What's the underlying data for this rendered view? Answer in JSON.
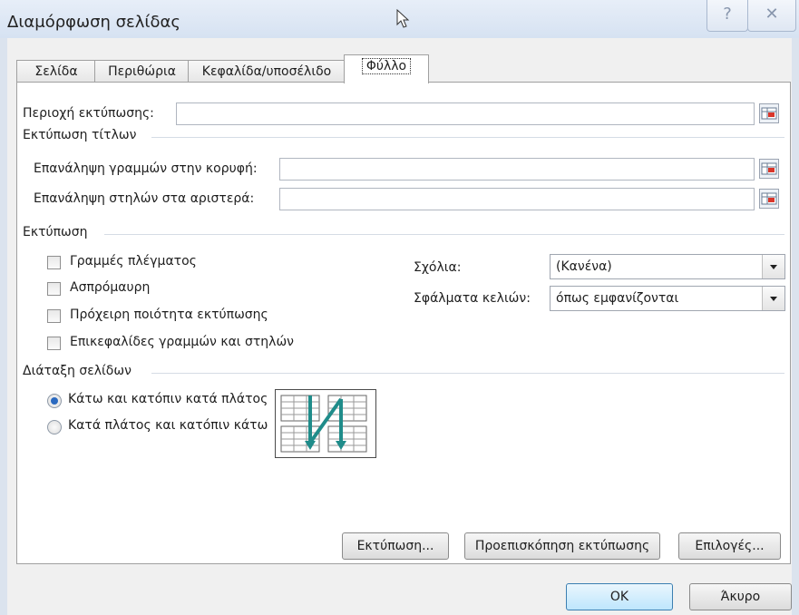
{
  "window": {
    "title": "Διαμόρφωση σελίδας",
    "help_icon": "help-icon",
    "close_icon": "close-icon"
  },
  "tabs": [
    {
      "label": "Σελίδα",
      "active": false
    },
    {
      "label": "Περιθώρια",
      "active": false
    },
    {
      "label": "Κεφαλίδα/υποσέλιδο",
      "active": false
    },
    {
      "label": "Φύλλο",
      "active": true
    }
  ],
  "print_area": {
    "label": "Περιοχή εκτύπωσης:",
    "value": ""
  },
  "print_titles": {
    "section": "Εκτύπωση τίτλων",
    "rows_label": "Επανάληψη γραμμών στην κορυφή:",
    "rows_value": "",
    "cols_label": "Επανάληψη στηλών στα αριστερά:",
    "cols_value": ""
  },
  "print": {
    "section": "Εκτύπωση",
    "checkboxes": [
      {
        "label": "Γραμμές πλέγματος",
        "checked": false
      },
      {
        "label": "Ασπρόμαυρη",
        "checked": false
      },
      {
        "label": "Πρόχειρη ποιότητα εκτύπωσης",
        "checked": false
      },
      {
        "label": "Επικεφαλίδες γραμμών και στηλών",
        "checked": false
      }
    ],
    "comments_label": "Σχόλια:",
    "comments_value": "(Κανένα)",
    "errors_label": "Σφάλματα κελιών:",
    "errors_value": "όπως εμφανίζονται"
  },
  "page_order": {
    "section": "Διάταξη σελίδων",
    "options": [
      {
        "label": "Κάτω και κατόπιν κατά πλάτος",
        "selected": true
      },
      {
        "label": "Κατά πλάτος και κατόπιν κάτω",
        "selected": false
      }
    ]
  },
  "buttons": {
    "print": "Εκτύπωση...",
    "preview": "Προεπισκόπηση εκτύπωσης",
    "options": "Επιλογές...",
    "ok": "OK",
    "cancel": "Άκυρο"
  },
  "colors": {
    "accent": "#1f8c8a",
    "selected_radio": "#2b6ac0"
  }
}
